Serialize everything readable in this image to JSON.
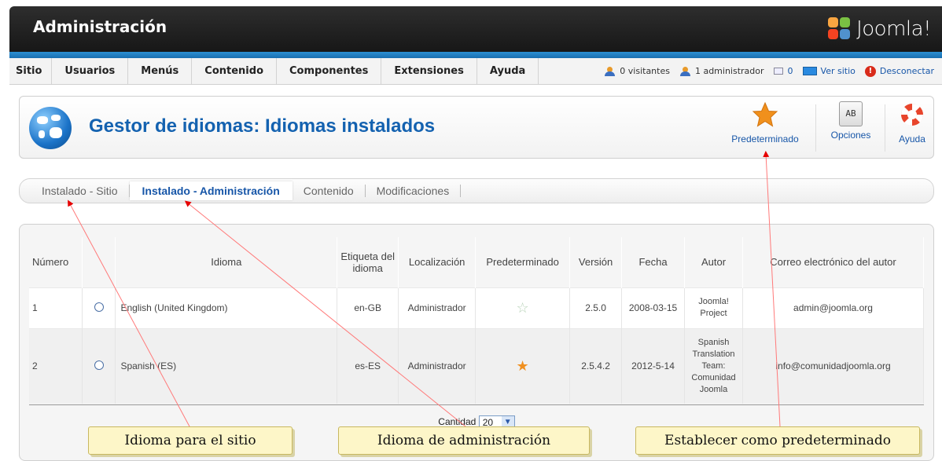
{
  "header": {
    "title": "Administración",
    "logo_text": "Joomla!"
  },
  "menu": [
    {
      "label": "Sitio"
    },
    {
      "label": "Usuarios"
    },
    {
      "label": "Menús"
    },
    {
      "label": "Contenido"
    },
    {
      "label": "Componentes"
    },
    {
      "label": "Extensiones"
    },
    {
      "label": "Ayuda"
    }
  ],
  "status": {
    "visitors": "0 visitantes",
    "admins": "1 administrador",
    "messages": "0",
    "view_site": "Ver sitio",
    "logout": "Desconectar"
  },
  "toolbar": {
    "page_title": "Gestor de idiomas: Idiomas instalados",
    "default_button": "Predeterminado",
    "options_button": "Opciones",
    "help_button": "Ayuda",
    "options_icon_text": "AB"
  },
  "tabs": [
    {
      "label": "Instalado - Sitio",
      "active": false
    },
    {
      "label": "Instalado - Administración",
      "active": true
    },
    {
      "label": "Contenido",
      "active": false
    },
    {
      "label": "Modificaciones",
      "active": false
    }
  ],
  "table": {
    "headers": {
      "numero": "Número",
      "idioma": "Idioma",
      "etiqueta": "Etiqueta del idioma",
      "localizacion": "Localización",
      "predeterminado": "Predeterminado",
      "version": "Versión",
      "fecha": "Fecha",
      "autor": "Autor",
      "correo": "Correo electrónico del autor"
    },
    "rows": [
      {
        "num": "1",
        "idioma": "English (United Kingdom)",
        "etiqueta": "en-GB",
        "localizacion": "Administrador",
        "default": false,
        "version": "2.5.0",
        "fecha": "2008-03-15",
        "autor": "Joomla! Project",
        "correo": "admin@joomla.org"
      },
      {
        "num": "2",
        "idioma": "Spanish (ES)",
        "etiqueta": "es-ES",
        "localizacion": "Administrador",
        "default": true,
        "version": "2.5.4.2",
        "fecha": "2012-5-14",
        "autor": "Spanish Translation Team: Comunidad Joomla",
        "correo": "info@comunidadjoomla.org"
      }
    ],
    "limit_label": "Cantidad",
    "limit_value": "20"
  },
  "callouts": {
    "site": "Idioma para el sitio",
    "admin": "Idioma de administración",
    "default": "Establecer como predeterminado"
  },
  "colors": {
    "accent_blue": "#1462b0",
    "header_dark": "#1f1f1f",
    "star_orange": "#f09020"
  }
}
